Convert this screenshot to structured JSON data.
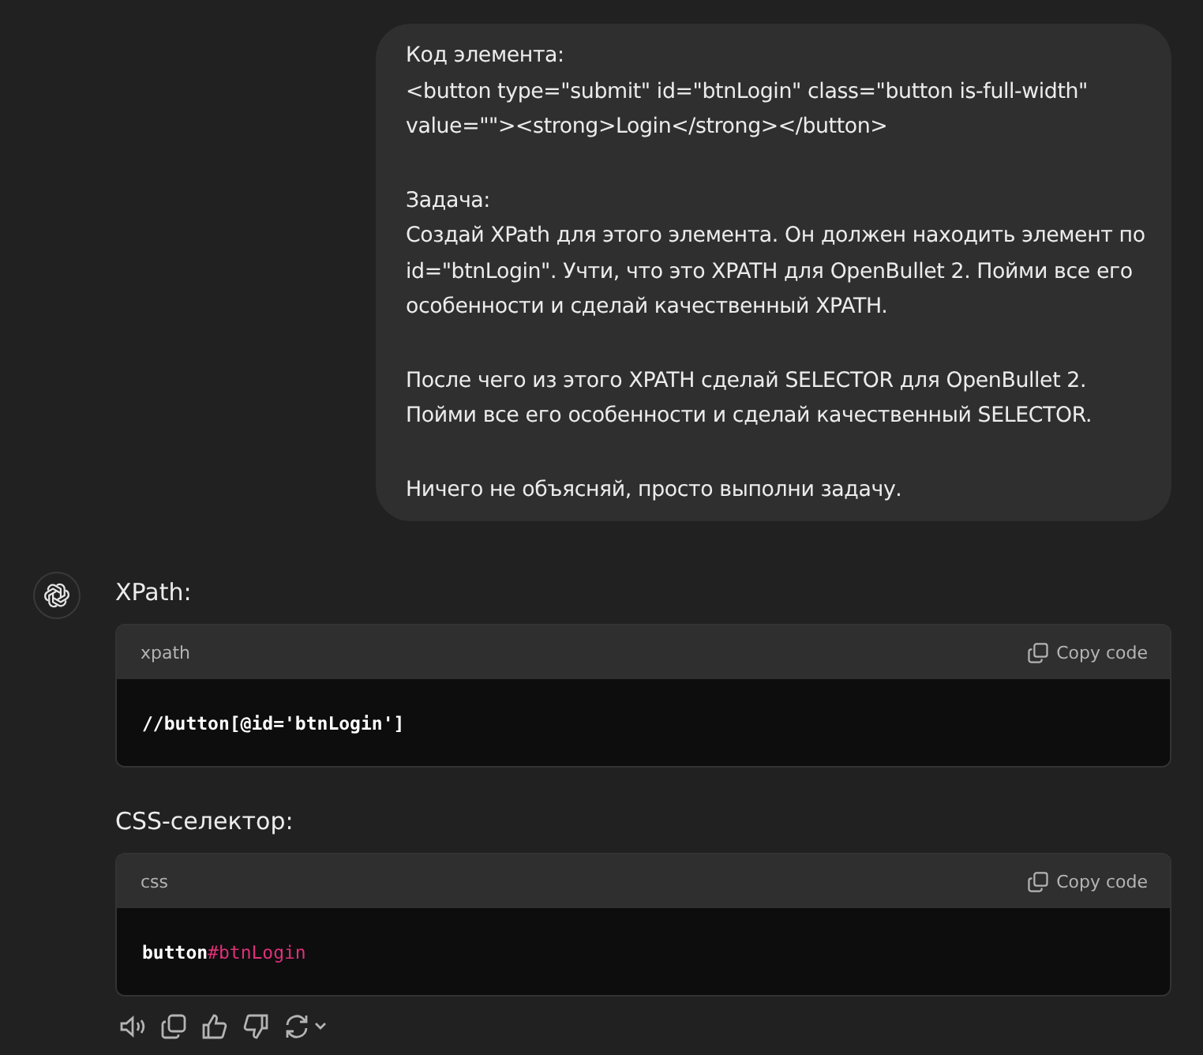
{
  "user_message": {
    "paragraphs": [
      [
        "Код элемента:",
        "<button type=\"submit\" id=\"btnLogin\" class=\"button is-full-width\"",
        "value=\"\"><strong>Login</strong></button>"
      ],
      [
        "Задача:",
        "Создай XPath для этого элемента. Он должен находить элемент по",
        "id=\"btnLogin\". Учти, что это XPATH для OpenBullet 2. Пойми все его",
        "особенности и сделай качественный XPATH."
      ],
      [
        "После чего из этого XPATH сделай SELECTOR для OpenBullet 2.",
        "Пойми все его особенности и сделай качественный SELECTOR."
      ],
      [
        "Ничего не объясняй, просто выполни задачу."
      ]
    ]
  },
  "assistant_message": {
    "sections": [
      {
        "heading": "XPath:",
        "code": {
          "language": "xpath",
          "copy_label": "Copy code",
          "tokens": [
            {
              "kind": "plain",
              "text": "//button[@id='btnLogin']"
            }
          ]
        }
      },
      {
        "heading": "CSS-селектор:",
        "code": {
          "language": "css",
          "copy_label": "Copy code",
          "tokens": [
            {
              "kind": "plain",
              "text": "button"
            },
            {
              "kind": "selector",
              "text": "#btnLogin"
            }
          ]
        }
      }
    ]
  }
}
